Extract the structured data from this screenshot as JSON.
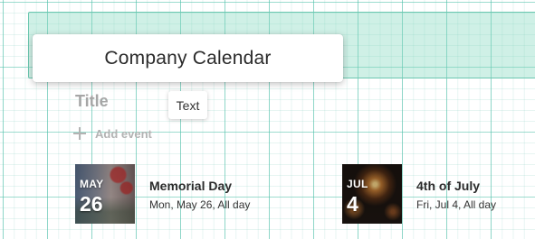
{
  "section": {
    "title": "Company Calendar"
  },
  "webpart": {
    "title_placeholder": "Title",
    "tooltip": "Text",
    "add_event_label": "Add event"
  },
  "events": [
    {
      "month": "MAY",
      "day": "26",
      "name": "Memorial Day",
      "when": "Mon, May 26, All day"
    },
    {
      "month": "JUL",
      "day": "4",
      "name": "4th of July",
      "when": "Fri, Jul 4, All day"
    }
  ],
  "colors": {
    "grid_accent": "#46bea5",
    "section_fill": "#82d7be",
    "placeholder_text": "#a6a6a6"
  }
}
